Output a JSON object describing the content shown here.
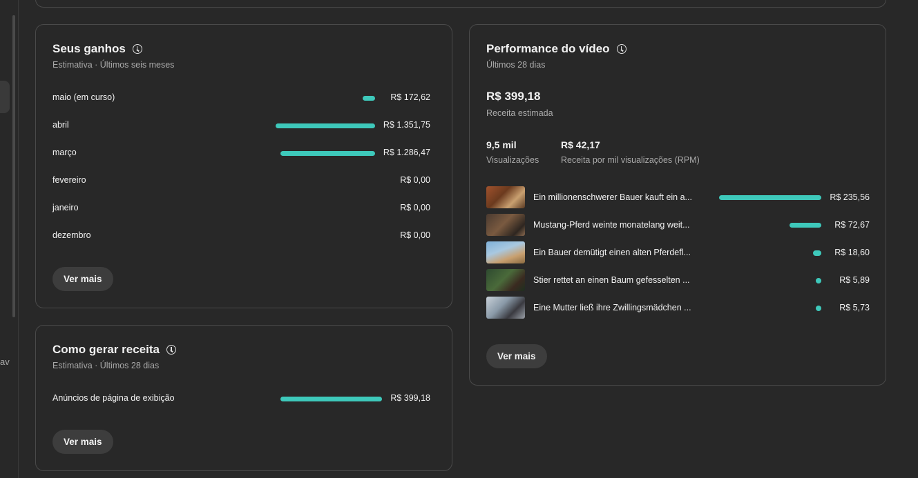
{
  "rail": {
    "text": "av"
  },
  "earnings": {
    "title": "Seus ganhos",
    "subtitle": "Estimativa · Últimos seis meses",
    "rows": [
      {
        "label": "maio (em curso)",
        "value": "R$ 172,62",
        "amount": 172.62
      },
      {
        "label": "abril",
        "value": "R$ 1.351,75",
        "amount": 1351.75
      },
      {
        "label": "março",
        "value": "R$ 1.286,47",
        "amount": 1286.47
      },
      {
        "label": "fevereiro",
        "value": "R$ 0,00",
        "amount": 0
      },
      {
        "label": "janeiro",
        "value": "R$ 0,00",
        "amount": 0
      },
      {
        "label": "dezembro",
        "value": "R$ 0,00",
        "amount": 0
      }
    ],
    "button": "Ver mais"
  },
  "how": {
    "title": "Como gerar receita",
    "subtitle": "Estimativa · Últimos 28 dias",
    "rows": [
      {
        "label": "Anúncios de página de exibição",
        "value": "R$ 399,18",
        "amount": 399.18
      }
    ],
    "button": "Ver mais"
  },
  "performance": {
    "title": "Performance do vídeo",
    "subtitle": "Últimos 28 dias",
    "revenue_value": "R$ 399,18",
    "revenue_label": "Receita estimada",
    "views_value": "9,5 mil",
    "views_label": "Visualizações",
    "rpm_value": "R$ 42,17",
    "rpm_label": "Receita por mil visualizações (RPM)",
    "videos": [
      {
        "title": "Ein millionenschwerer Bauer kauft ein a...",
        "value": "R$ 235,56",
        "amount": 235.56
      },
      {
        "title": "Mustang-Pferd weinte monatelang weit...",
        "value": "R$ 72,67",
        "amount": 72.67
      },
      {
        "title": "Ein Bauer demütigt einen alten Pferdefl...",
        "value": "R$ 18,60",
        "amount": 18.6
      },
      {
        "title": "Stier rettet an einen Baum gefesselten ...",
        "value": "R$ 5,89",
        "amount": 5.89
      },
      {
        "title": "Eine Mutter ließ ihre Zwillingsmädchen ...",
        "value": "R$ 5,73",
        "amount": 5.73
      }
    ],
    "button": "Ver mais"
  },
  "colors": {
    "accent": "#3ec9bb",
    "background": "#282828",
    "border": "#4a4a4a"
  }
}
